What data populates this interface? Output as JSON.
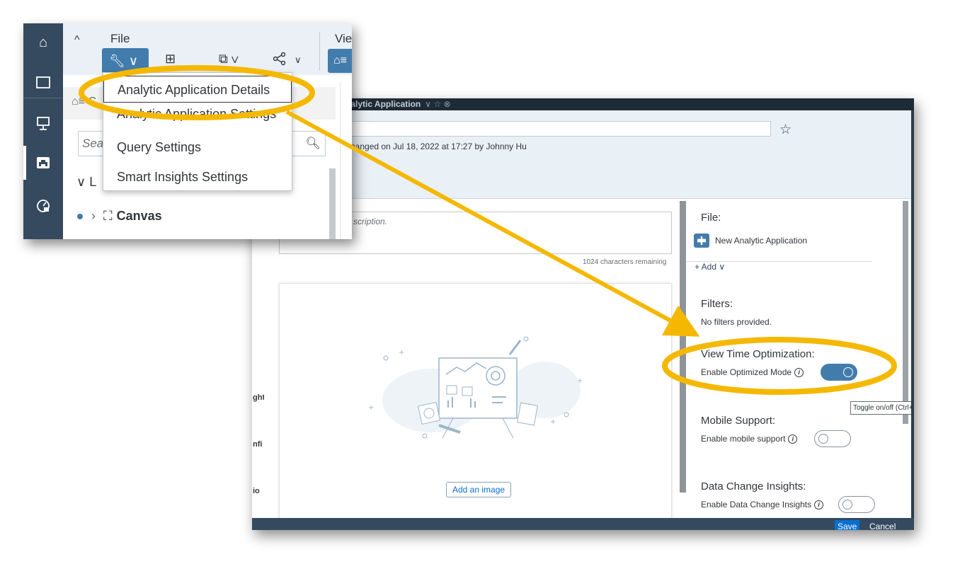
{
  "dialog": {
    "tab_title": "nalytic Application",
    "tab_title_icons": "∨   ☆   ⊗",
    "app_name": "ic Application",
    "changed_text": "nanged on Jul 18, 2022 at 17:27 by Johnny Hu",
    "description_placeholder": "scription.",
    "chars_remaining": "1024 characters remaining",
    "add_image_label": "Add an image",
    "left_fragments": [
      "ght",
      "nfi",
      "io"
    ],
    "file_heading": "File:",
    "file_name": "New Analytic Application",
    "add_label": "+ Add ∨",
    "filters_heading": "Filters:",
    "filters_text": "No filters provided.",
    "vto_heading": "View Time Optimization:",
    "vto_label": "Enable Optimized Mode",
    "vto_enabled": true,
    "tooltip": "Toggle on/off (Ctrl+O",
    "mobile_heading": "Mobile Support:",
    "mobile_label": "Enable mobile support",
    "mobile_enabled": false,
    "dci_heading": "Data Change Insights:",
    "dci_label": "Enable Data Change Insights",
    "dci_enabled": false,
    "save_label": "Save",
    "cancel_label": "Cancel"
  },
  "toolbar": {
    "file_label": "File",
    "view_label": "Vie",
    "collapse_glyph": "^",
    "search_placeholder": "Sea",
    "layout_label": "L",
    "canvas_label": "Canvas",
    "menu_items": [
      "Analytic Application Details",
      "Analytic Application Settings",
      "Query Settings",
      "Smart Insights Settings"
    ]
  },
  "icons": {
    "home": "home-icon",
    "folder": "folder-icon",
    "presentation": "presentation-icon",
    "application": "analytic-application-icon",
    "dashboard": "dashboard-icon"
  },
  "colors": {
    "shell": "#354a5f",
    "accent": "#427cac",
    "annotation": "#f5b800"
  }
}
